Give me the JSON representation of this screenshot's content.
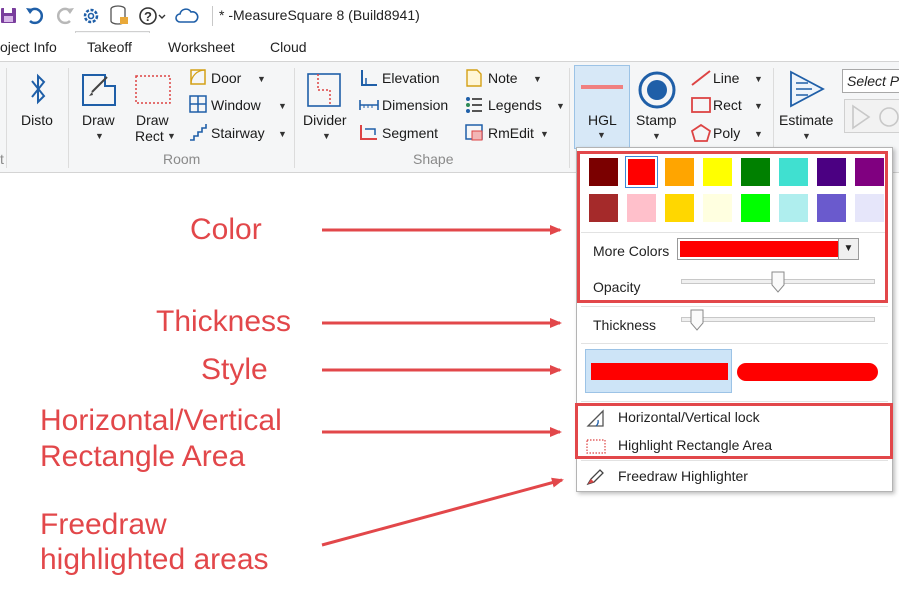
{
  "app": {
    "title": "* -MeasureSquare 8 (Build8941)"
  },
  "quick_access_icons": [
    "save-icon",
    "undo-icon",
    "redo-icon",
    "gear-icon",
    "database-icon",
    "help-icon",
    "cloud-icon"
  ],
  "tabs": [
    {
      "label": "oject Info",
      "active": false
    },
    {
      "label": "Takeoff",
      "active": true
    },
    {
      "label": "Worksheet",
      "active": false
    },
    {
      "label": "Cloud",
      "active": false
    }
  ],
  "ribbon": {
    "groups": {
      "first": "t",
      "room": "Room",
      "shape": "Shape"
    },
    "buttons": {
      "disto": "Disto",
      "draw": "Draw",
      "draw_rect_1": "Draw",
      "draw_rect_2": "Rect",
      "door": "Door",
      "window": "Window",
      "stairway": "Stairway",
      "divider": "Divider",
      "elevation": "Elevation",
      "dimension": "Dimension",
      "segment": "Segment",
      "note": "Note",
      "legends": "Legends",
      "rmedit": "RmEdit",
      "hgl": "HGL",
      "stamp": "Stamp",
      "line": "Line",
      "rect": "Rect",
      "poly": "Poly",
      "estimate": "Estimate",
      "select_partial": "Select Pr"
    }
  },
  "hgl_panel": {
    "colors_row1": [
      "#7b0000",
      "#ff0000",
      "#ffa500",
      "#ffff00",
      "#008000",
      "#40e0d0",
      "#4b0082",
      "#800080"
    ],
    "colors_row2": [
      "#a52a2a",
      "#ffc0cb",
      "#ffd700",
      "#ffffe0",
      "#00ff00",
      "#afeeee",
      "#6a5acd",
      "#e6e6fa"
    ],
    "selected_color": "#ff0000",
    "more_colors_label": "More Colors",
    "opacity_label": "Opacity",
    "opacity_value": 0.5,
    "thickness_label": "Thickness",
    "thickness_value": 0.05,
    "lock_label": "Horizontal/Vertical lock",
    "rect_area_label": "Highlight Rectangle Area",
    "freedraw_label": "Freedraw Highlighter"
  },
  "annotations": {
    "color": "Color",
    "thickness": "Thickness",
    "style": "Style",
    "hv_line1": "Horizontal/Vertical",
    "hv_line2": "Rectangle Area",
    "freedraw_line1": "Freedraw",
    "freedraw_line2": "highlighted areas",
    "color_value": "#e2474a"
  }
}
